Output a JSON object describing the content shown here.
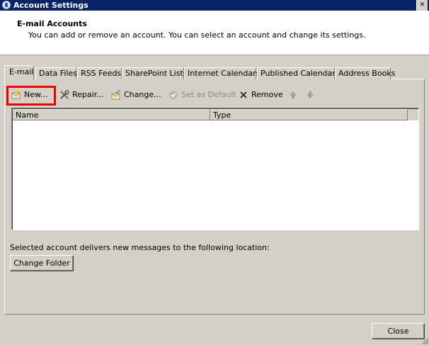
{
  "window": {
    "title": "Account Settings",
    "close_glyph": "✕",
    "icon": "mail-app-icon"
  },
  "header": {
    "title": "E-mail Accounts",
    "description": "You can add or remove an account. You can select an account and change its settings."
  },
  "tabs": [
    {
      "label": "E-mail",
      "active": true
    },
    {
      "label": "Data Files"
    },
    {
      "label": "RSS Feeds"
    },
    {
      "label": "SharePoint Lists"
    },
    {
      "label": "Internet Calendars"
    },
    {
      "label": "Published Calendars"
    },
    {
      "label": "Address Books"
    }
  ],
  "toolbar": {
    "new_label": "New...",
    "repair_label": "Repair...",
    "change_label": "Change...",
    "set_default_label": "Set as Default",
    "remove_label": "Remove",
    "highlight_color": "#e00000"
  },
  "list": {
    "columns": [
      "Name",
      "Type"
    ],
    "rows": []
  },
  "footer": {
    "deliver_text": "Selected account delivers new messages to the following location:",
    "change_folder_label": "Change Folder",
    "close_label": "Close"
  }
}
